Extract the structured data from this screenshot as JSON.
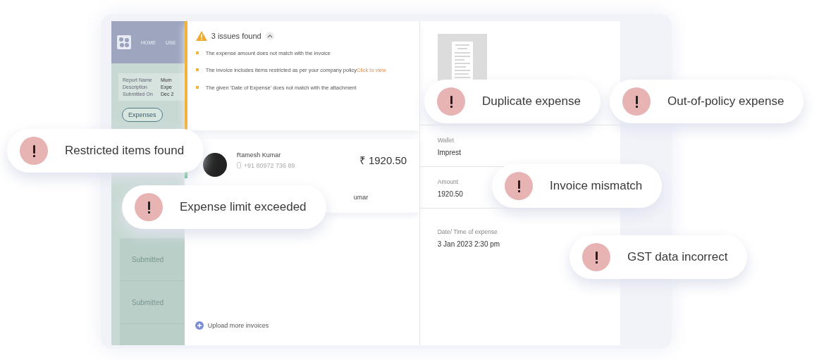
{
  "sidebar": {
    "nav": [
      "HOME",
      "USE"
    ],
    "report": [
      {
        "label": "Report Name",
        "value": "Mum"
      },
      {
        "label": "Description",
        "value": "Expe"
      },
      {
        "label": "Submitted On",
        "value": "Dec 2"
      }
    ],
    "tabs": [
      {
        "label": "Expenses",
        "selected": true
      }
    ],
    "statuses": [
      "Submitted",
      "Submitted"
    ]
  },
  "issues": {
    "title": "3 issues found",
    "expanded": true,
    "items": [
      {
        "text": "The expense amount does not match with the invoice"
      },
      {
        "text": "The invoice includes items restricted as per your company policy",
        "link": "Click to view"
      },
      {
        "text": "The given 'Date of Expense' does not match with the attachment"
      }
    ]
  },
  "claims": [
    {
      "name": "Ramesh Kumar",
      "phone": "+91 80972 736 89",
      "amount": "₹ 1920.50",
      "selected": true
    },
    {
      "name": "umar"
    }
  ],
  "upload": "Upload more invoices",
  "details": [
    {
      "label": "Wallet",
      "value": "Imprest"
    },
    {
      "label": "Amount",
      "value": "1920.50"
    },
    {
      "label": "Date/ Time of expense",
      "value": "3 Jan 2023  2:30 pm"
    }
  ],
  "alerts": [
    "Restricted items found",
    "Expense limit exceeded",
    "Duplicate expense",
    "Out-of-policy expense",
    "Invoice mismatch",
    "GST data incorrect"
  ]
}
